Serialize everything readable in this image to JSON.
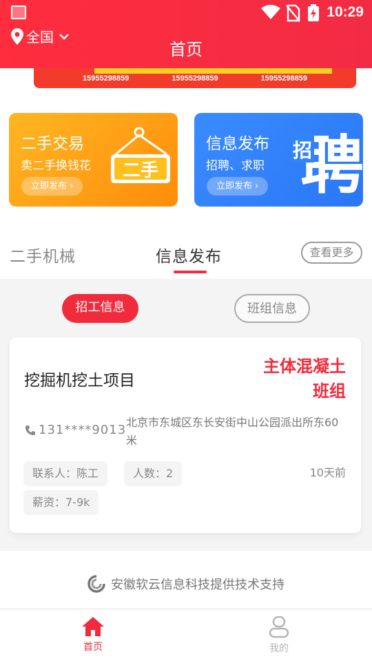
{
  "status": {
    "time": "10:29"
  },
  "header": {
    "location": "全国",
    "title": "首页"
  },
  "banner": {
    "phones": [
      "15955298859",
      "15955298859",
      "15955298859"
    ]
  },
  "cards": [
    {
      "title": "二手交易",
      "subtitle": "卖二手换钱花",
      "button": "立即发布",
      "art_text": "二手",
      "color": "#ff9a14"
    },
    {
      "title": "信息发布",
      "subtitle": "招聘、求职",
      "button": "立即发布",
      "art_text": "聘",
      "art_small": "招",
      "color": "#3284fb"
    }
  ],
  "tabs": {
    "items": [
      "二手机械",
      "信息发布"
    ],
    "active": 1,
    "more": "查看更多"
  },
  "filters": {
    "items": [
      "招工信息",
      "班组信息"
    ],
    "active": 0
  },
  "job": {
    "title": "挖掘机挖土项目",
    "team": "主体混凝土班组",
    "phone": "131****9013",
    "address": "北京市东城区东长安街中山公园派出所东60米",
    "contact": "联系人：陈工",
    "count": "人数：2",
    "salary": "薪资：7-9k",
    "time": "10天前"
  },
  "footer": {
    "support": "安徽软云信息科技提供技术支持"
  },
  "bottom_nav": {
    "home": "首页",
    "mine": "我的"
  },
  "colors": {
    "accent": "#f22b3c",
    "orange": "#ff9a14",
    "blue": "#3284fb"
  }
}
